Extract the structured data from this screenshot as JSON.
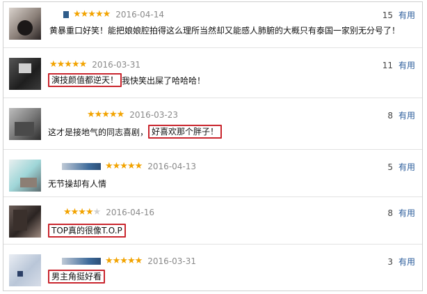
{
  "reviews": [
    {
      "stars_filled": "★★★★★",
      "stars_empty": "",
      "date": "2016-04-14",
      "votes": "15",
      "useful": "有用",
      "pre": "",
      "highlight": "",
      "text": "黄暴重口好笑！能把娘娘腔拍得这么理所当然却又能感人肺腑的大概只有泰国一家别无分号了！"
    },
    {
      "stars_filled": "★★★★★",
      "stars_empty": "",
      "date": "2016-03-31",
      "votes": "11",
      "useful": "有用",
      "pre": "",
      "highlight": "演技颜值都逆天！",
      "text": "我快笑出屎了哈哈哈！"
    },
    {
      "stars_filled": "★★★★★",
      "stars_empty": "",
      "date": "2016-03-23",
      "votes": "8",
      "useful": "有用",
      "pre": "这才是接地气的同志喜剧，",
      "highlight": "好喜欢那个胖子！",
      "text": ""
    },
    {
      "stars_filled": "★★★★★",
      "stars_empty": "",
      "date": "2016-04-13",
      "votes": "5",
      "useful": "有用",
      "pre": "",
      "highlight": "",
      "text": "无节操却有人情"
    },
    {
      "stars_filled": "★★★★",
      "stars_empty": "★",
      "date": "2016-04-16",
      "votes": "8",
      "useful": "有用",
      "pre": "",
      "highlight": "TOP真的很像T.O.P",
      "text": ""
    },
    {
      "stars_filled": "★★★★★",
      "stars_empty": "",
      "date": "2016-03-31",
      "votes": "3",
      "useful": "有用",
      "pre": "",
      "highlight": "男主角挺好看",
      "text": ""
    }
  ],
  "colors": {
    "star": "#f2a300",
    "highlight_border": "#c9252d",
    "useful_link": "#2b5c9b"
  }
}
